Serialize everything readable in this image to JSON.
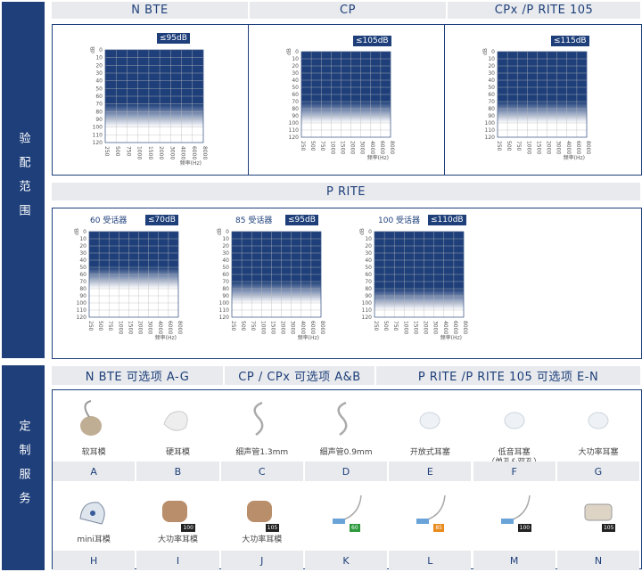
{
  "side_labels": {
    "fitting": "验配范围",
    "custom": "定制服务"
  },
  "headers": {
    "nbte": "N BTE",
    "cp": "CP",
    "cpx": "CPx /P RITE 105",
    "prite": "P RITE"
  },
  "fitting": {
    "nbte": {
      "badge": "≤95dB"
    },
    "cp": {
      "badge": "≤105dB"
    },
    "cpx": {
      "badge": "≤115dB"
    },
    "prite60": {
      "caption": "60 受话器",
      "badge": "≤70dB"
    },
    "prite85": {
      "caption": "85 受话器",
      "badge": "≤95dB"
    },
    "prite100": {
      "caption": "100 受话器",
      "badge": "≤110dB"
    }
  },
  "axis": {
    "ylabel": "dB",
    "xlabel": "频率(Hz)",
    "y_ticks": [
      "0",
      "10",
      "20",
      "30",
      "40",
      "50",
      "60",
      "70",
      "80",
      "90",
      "100",
      "110",
      "120"
    ],
    "x_ticks": [
      "250",
      "500",
      "750",
      "1000",
      "1500",
      "2000",
      "3000",
      "4000",
      "6000",
      "8000"
    ]
  },
  "options_headers": {
    "a": "N BTE 可选项 A-G",
    "b": "CP / CPx 可选项 A&B",
    "c": "P RITE /P RITE 105 可选项 E-N"
  },
  "options_row1": [
    {
      "label": "软耳模",
      "letter": "A"
    },
    {
      "label": "硬耳模",
      "letter": "B"
    },
    {
      "label": "细声管1.3mm",
      "letter": "C"
    },
    {
      "label": "细声管0.9mm",
      "letter": "D"
    },
    {
      "label": "开放式耳塞",
      "letter": "E"
    },
    {
      "label": "低音耳塞",
      "label2": "（单孔&双孔）",
      "letter": "F"
    },
    {
      "label": "大功率耳塞",
      "letter": "G"
    }
  ],
  "options_row2": [
    {
      "label": "mini耳模",
      "letter": "H"
    },
    {
      "label": "大功率耳模",
      "letter": "I",
      "tag": "100"
    },
    {
      "label": "大功率耳模",
      "letter": "J",
      "tag": "105"
    },
    {
      "label": "",
      "letter": "K",
      "tag": "60"
    },
    {
      "label": "",
      "letter": "L",
      "tag": "85"
    },
    {
      "label": "",
      "letter": "M",
      "tag": "100"
    },
    {
      "label": "",
      "letter": "N",
      "tag": "105"
    }
  ],
  "colors": {
    "navy": "#1e3f7a",
    "green": "#2e9a3e",
    "orange": "#e88a1c",
    "black": "#222222"
  }
}
